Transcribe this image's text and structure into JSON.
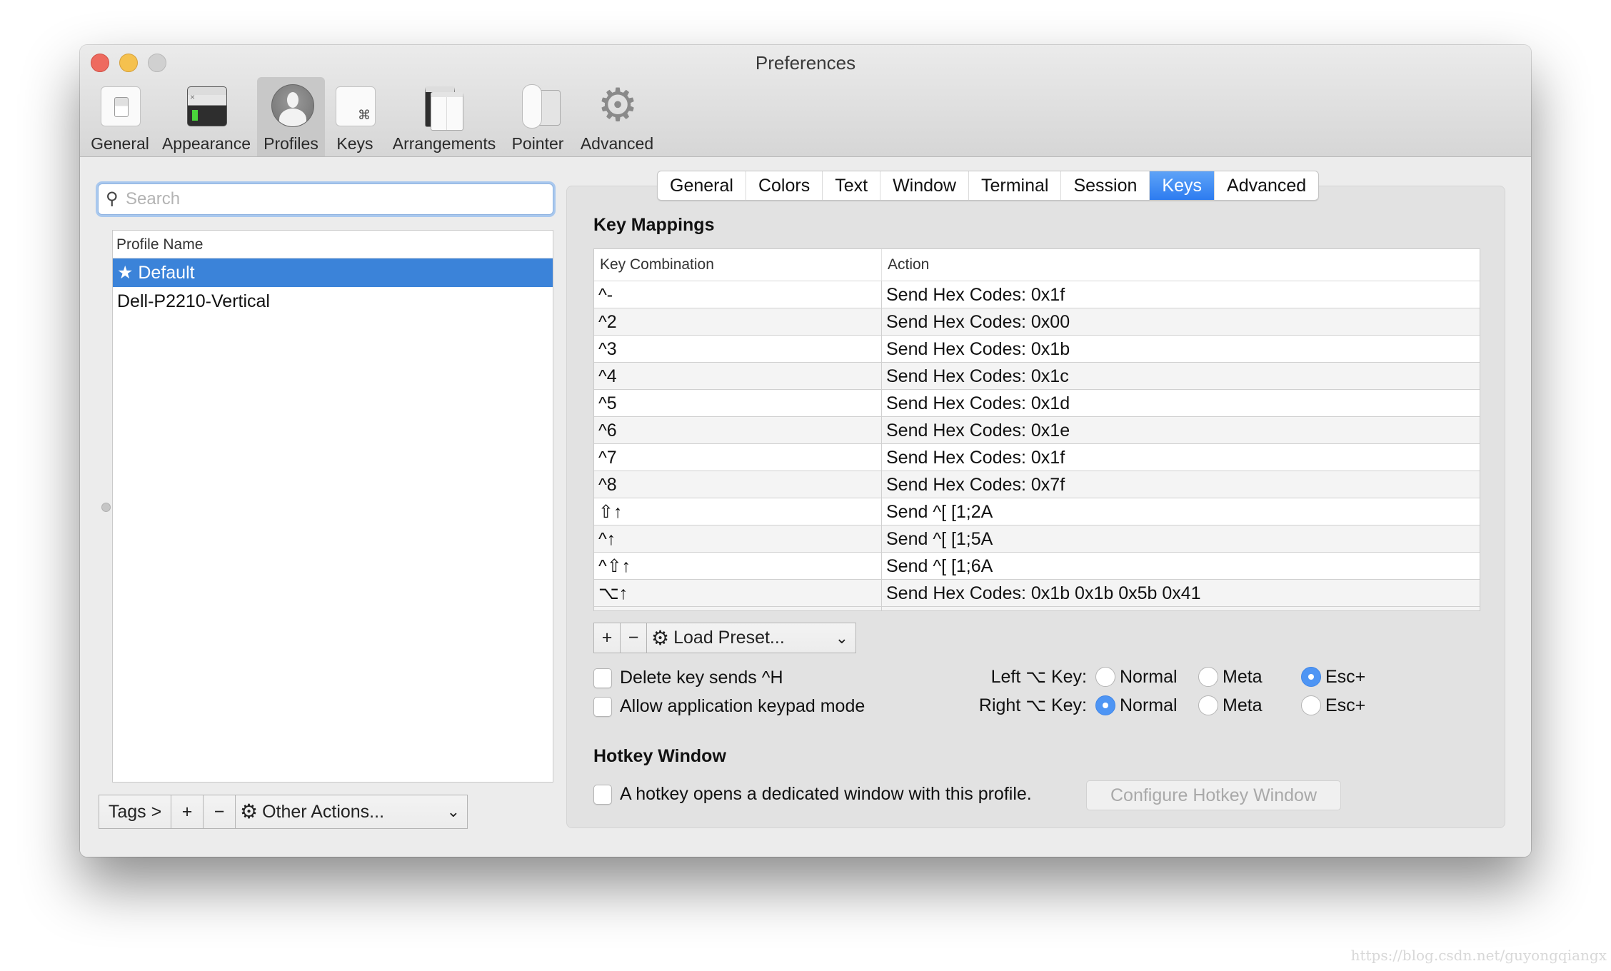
{
  "window": {
    "title": "Preferences"
  },
  "toolbar": {
    "items": [
      {
        "label": "General",
        "icon": "general-switch-icon"
      },
      {
        "label": "Appearance",
        "icon": "terminal-appearance-icon"
      },
      {
        "label": "Profiles",
        "icon": "profile-silhouette-icon",
        "active": true
      },
      {
        "label": "Keys",
        "icon": "command-key-icon"
      },
      {
        "label": "Arrangements",
        "icon": "window-arrangements-icon"
      },
      {
        "label": "Pointer",
        "icon": "mouse-pointer-icon"
      },
      {
        "label": "Advanced",
        "icon": "gear-icon"
      }
    ]
  },
  "profiles": {
    "search_placeholder": "Search",
    "search_value": "",
    "column_header": "Profile Name",
    "items": [
      {
        "name": "★ Default",
        "selected": true
      },
      {
        "name": "Dell-P2210-Vertical",
        "selected": false
      }
    ],
    "buttons": {
      "tags": "Tags >",
      "add": "+",
      "remove": "−",
      "other_actions": "Other Actions...",
      "other_actions_chevron": "⌄"
    }
  },
  "profile_tabs": {
    "items": [
      "General",
      "Colors",
      "Text",
      "Window",
      "Terminal",
      "Session",
      "Keys",
      "Advanced"
    ],
    "active": "Keys"
  },
  "key_mappings": {
    "title": "Key Mappings",
    "columns": [
      "Key Combination",
      "Action"
    ],
    "rows": [
      {
        "key": "^-",
        "action": "Send Hex Codes: 0x1f"
      },
      {
        "key": "^2",
        "action": "Send Hex Codes: 0x00"
      },
      {
        "key": "^3",
        "action": "Send Hex Codes: 0x1b"
      },
      {
        "key": "^4",
        "action": "Send Hex Codes: 0x1c"
      },
      {
        "key": "^5",
        "action": "Send Hex Codes: 0x1d"
      },
      {
        "key": "^6",
        "action": "Send Hex Codes: 0x1e"
      },
      {
        "key": "^7",
        "action": "Send Hex Codes: 0x1f"
      },
      {
        "key": "^8",
        "action": "Send Hex Codes: 0x7f"
      },
      {
        "key": "⇧↑",
        "action": "Send ^[ [1;2A"
      },
      {
        "key": "^↑",
        "action": "Send ^[ [1;5A"
      },
      {
        "key": "^⇧↑",
        "action": "Send ^[ [1;6A"
      },
      {
        "key": "⌥↑",
        "action": "Send Hex Codes: 0x1b 0x1b 0x5b 0x41"
      }
    ],
    "add_button": "+",
    "remove_button": "−",
    "load_preset": "Load Preset...",
    "load_preset_chevron": "⌄"
  },
  "options": {
    "delete_sends_h": {
      "label": "Delete key sends ^H",
      "checked": false
    },
    "app_keypad": {
      "label": "Allow application keypad mode",
      "checked": false
    },
    "left_option": {
      "label": "Left ⌥ Key:",
      "choices": [
        "Normal",
        "Meta",
        "Esc+"
      ],
      "selected": "Esc+"
    },
    "right_option": {
      "label": "Right ⌥ Key:",
      "choices": [
        "Normal",
        "Meta",
        "Esc+"
      ],
      "selected": "Normal"
    }
  },
  "hotkey": {
    "title": "Hotkey Window",
    "checkbox_label": "A hotkey opens a dedicated window with this profile.",
    "checked": false,
    "configure_button": "Configure Hotkey Window",
    "configure_enabled": false
  },
  "watermark": "https://blog.csdn.net/guyongqiangx",
  "colors": {
    "accent": "#3b83d9",
    "tab_active": "#2d7cf0",
    "radio_on": "#4e95f4",
    "close": "#ee6a5f",
    "minimize": "#f5c14e",
    "zoom_disabled": "#d0d0d0"
  }
}
